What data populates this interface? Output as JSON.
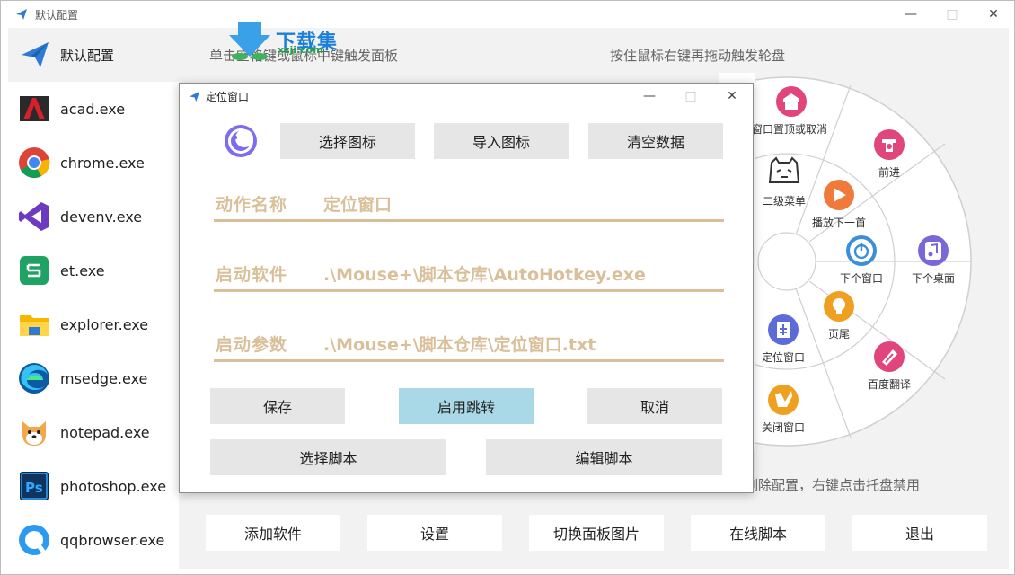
{
  "window": {
    "title": "默认配置"
  },
  "sidebar": {
    "header_label": "默认配置",
    "items": [
      {
        "label": "acad.exe",
        "icon": "autocad-icon"
      },
      {
        "label": "chrome.exe",
        "icon": "chrome-icon"
      },
      {
        "label": "devenv.exe",
        "icon": "visual-studio-icon"
      },
      {
        "label": "et.exe",
        "icon": "wps-sheet-icon"
      },
      {
        "label": "explorer.exe",
        "icon": "folder-icon"
      },
      {
        "label": "msedge.exe",
        "icon": "edge-icon"
      },
      {
        "label": "notepad.exe",
        "icon": "dog-icon"
      },
      {
        "label": "photoshop.exe",
        "icon": "photoshop-icon"
      },
      {
        "label": "qqbrowser.exe",
        "icon": "qqbrowser-icon"
      }
    ]
  },
  "hints": {
    "left": "单击空格键或鼠标中键触发面板",
    "right": "按住鼠标右键再拖动触发轮盘",
    "bottom": "删除配置，右键点击托盘禁用"
  },
  "watermark": {
    "text": "下载集",
    "sub": "xzji.com"
  },
  "wheel": {
    "items": [
      {
        "label": "窗口置顶或取消",
        "color": "#e0457b"
      },
      {
        "label": "前进",
        "color": "#e0457b"
      },
      {
        "label": "二级菜单",
        "color": "#333333"
      },
      {
        "label": "播放下一首",
        "color": "#f07a3a"
      },
      {
        "label": "下个窗口",
        "color": "#3b8fd8"
      },
      {
        "label": "下个桌面",
        "color": "#7b68d8"
      },
      {
        "label": "定位窗口",
        "color": "#5d6bd8"
      },
      {
        "label": "页尾",
        "color": "#f0a020"
      },
      {
        "label": "百度翻译",
        "color": "#e0457b"
      },
      {
        "label": "关闭窗口",
        "color": "#f0a020"
      }
    ]
  },
  "bottom_buttons": [
    "添加软件",
    "设置",
    "切换面板图片",
    "在线脚本",
    "退出"
  ],
  "dialog": {
    "title": "定位窗口",
    "top_buttons": [
      "选择图标",
      "导入图标",
      "清空数据"
    ],
    "fields": [
      {
        "label": "动作名称",
        "value": "定位窗口"
      },
      {
        "label": "启动软件",
        "value": ".\\Mouse+\\脚本仓库\\AutoHotkey.exe"
      },
      {
        "label": "启动参数",
        "value": ".\\Mouse+\\脚本仓库\\定位窗口.txt"
      }
    ],
    "action_buttons": {
      "save": "保存",
      "jump": "启用跳转",
      "cancel": "取消"
    },
    "script_buttons": {
      "choose": "选择脚本",
      "edit": "编辑脚本"
    }
  }
}
